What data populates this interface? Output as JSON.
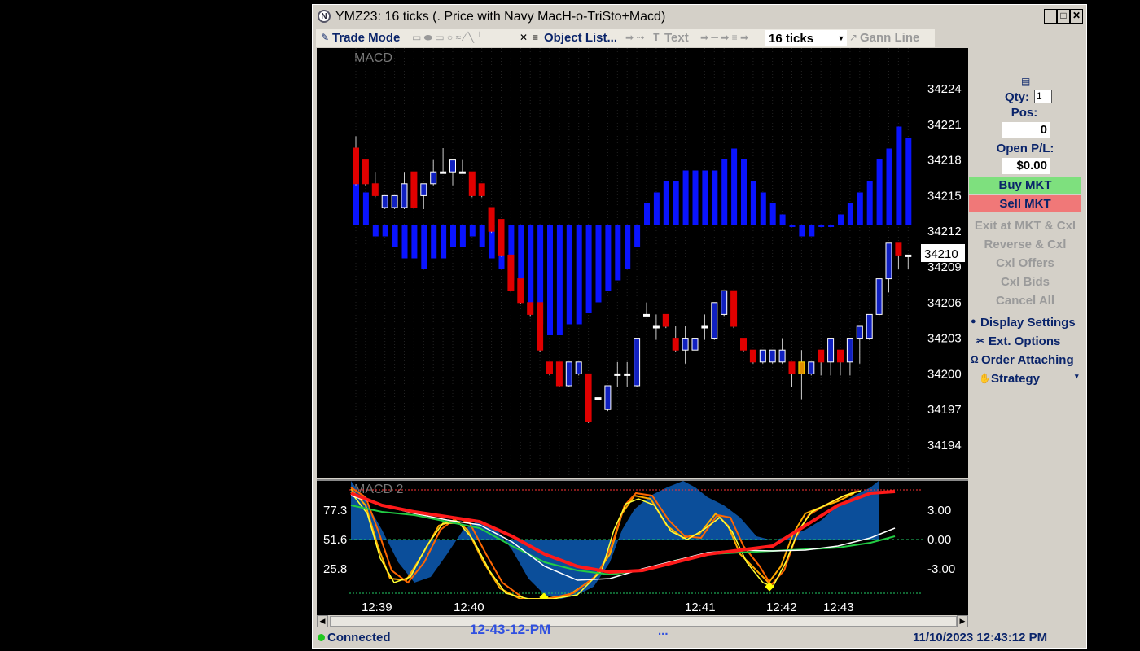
{
  "window": {
    "title": "YMZ23: 16 ticks (. Price with Navy MacH-o-TriSto+Macd)",
    "minimize": "_",
    "maximize": "□",
    "close": "✕"
  },
  "toolbar": {
    "trade_mode": "Trade Mode",
    "object_list": "Object List...",
    "text": "Text",
    "ticks": "16 ticks",
    "gann_line": "Gann Line"
  },
  "main_chart": {
    "label": "MACD",
    "price_axis": [
      "34224",
      "34221",
      "34218",
      "34215",
      "34212",
      "34209",
      "34206",
      "34203",
      "34200",
      "34197",
      "34194"
    ],
    "current_price": "34210"
  },
  "sub_chart": {
    "label": "MACD 2",
    "left_axis": [
      "77.3",
      "51.6",
      "25.8"
    ],
    "right_axis": [
      "3.00",
      "0.00",
      "-3.00"
    ]
  },
  "time_axis": [
    "12:39",
    "12:40",
    "12:41",
    "12:42",
    "12:43"
  ],
  "side_panel": {
    "qty_label": "Qty:",
    "qty_value": "1",
    "pos_label": "Pos:",
    "pos_value": "0",
    "open_pl_label": "Open P/L:",
    "open_pl_value": "$0.00",
    "buy_mkt": "Buy MKT",
    "sell_mkt": "Sell MKT",
    "exit_at_mkt": "Exit at MKT & Cxl",
    "reverse": "Reverse & Cxl",
    "cxl_offers": "Cxl Offers",
    "cxl_bids": "Cxl Bids",
    "cancel_all": "Cancel All",
    "display_settings": "Display Settings",
    "ext_options": "Ext. Options",
    "order_attaching": "Order Attaching",
    "strategy": "Strategy"
  },
  "status": {
    "connection": "Connected",
    "center_time": "12-43-12-PM",
    "ellipsis": "...",
    "datetime": "11/10/2023 12:43:12 PM"
  },
  "colors": {
    "buy": "#7ee07e",
    "sell": "#f07878",
    "histogram": "#0a14ff",
    "connected": "#1ec81e"
  },
  "chart_data": {
    "type": "candlestick",
    "candles": [
      {
        "o": 34216,
        "c": 34219,
        "h": 34220,
        "l": 34216,
        "color": "red"
      },
      {
        "o": 34218,
        "c": 34216,
        "h": 34218,
        "l": 34216,
        "color": "red"
      },
      {
        "o": 34216,
        "c": 34215,
        "h": 34217,
        "l": 34215,
        "color": "red"
      },
      {
        "o": 34215,
        "c": 34214,
        "h": 34215,
        "l": 34214,
        "color": "blue"
      },
      {
        "o": 34215,
        "c": 34214,
        "h": 34215,
        "l": 34214,
        "color": "blue"
      },
      {
        "o": 34214,
        "c": 34216,
        "h": 34217,
        "l": 34214,
        "color": "blue"
      },
      {
        "o": 34217,
        "c": 34214,
        "h": 34217,
        "l": 34214,
        "color": "red"
      },
      {
        "o": 34215,
        "c": 34216,
        "h": 34216,
        "l": 34214,
        "color": "blue"
      },
      {
        "o": 34216,
        "c": 34217,
        "h": 34218,
        "l": 34216,
        "color": "blue"
      },
      {
        "o": 34217,
        "c": 34217,
        "h": 34219,
        "l": 34217,
        "color": "white"
      },
      {
        "o": 34217,
        "c": 34218,
        "h": 34218,
        "l": 34216,
        "color": "blue"
      },
      {
        "o": 34217,
        "c": 34217,
        "h": 34218,
        "l": 34217,
        "color": "white"
      },
      {
        "o": 34217,
        "c": 34215,
        "h": 34217,
        "l": 34215,
        "color": "red"
      },
      {
        "o": 34216,
        "c": 34215,
        "h": 34216,
        "l": 34215,
        "color": "red"
      },
      {
        "o": 34214,
        "c": 34212,
        "h": 34214,
        "l": 34212,
        "color": "red"
      },
      {
        "o": 34213,
        "c": 34210,
        "h": 34213,
        "l": 34210,
        "color": "red"
      },
      {
        "o": 34210,
        "c": 34207,
        "h": 34210,
        "l": 34207,
        "color": "red"
      },
      {
        "o": 34208,
        "c": 34206,
        "h": 34208,
        "l": 34206,
        "color": "red"
      },
      {
        "o": 34206,
        "c": 34205,
        "h": 34206,
        "l": 34205,
        "color": "red"
      },
      {
        "o": 34206,
        "c": 34202,
        "h": 34206,
        "l": 34202,
        "color": "red"
      },
      {
        "o": 34201,
        "c": 34200,
        "h": 34201,
        "l": 34200,
        "color": "red"
      },
      {
        "o": 34201,
        "c": 34199,
        "h": 34201,
        "l": 34199,
        "color": "red"
      },
      {
        "o": 34199,
        "c": 34201,
        "h": 34201,
        "l": 34199,
        "color": "blue"
      },
      {
        "o": 34200,
        "c": 34201,
        "h": 34201,
        "l": 34200,
        "color": "blue"
      },
      {
        "o": 34200,
        "c": 34196,
        "h": 34200,
        "l": 34196,
        "color": "red"
      },
      {
        "o": 34198,
        "c": 34198,
        "h": 34199,
        "l": 34197,
        "color": "white"
      },
      {
        "o": 34197,
        "c": 34199,
        "h": 34199,
        "l": 34197,
        "color": "blue"
      },
      {
        "o": 34200,
        "c": 34200,
        "h": 34201,
        "l": 34199,
        "color": "white"
      },
      {
        "o": 34200,
        "c": 34200,
        "h": 34201,
        "l": 34199,
        "color": "white"
      },
      {
        "o": 34199,
        "c": 34203,
        "h": 34203,
        "l": 34199,
        "color": "blue"
      },
      {
        "o": 34205,
        "c": 34205,
        "h": 34206,
        "l": 34205,
        "color": "white"
      },
      {
        "o": 34204,
        "c": 34204,
        "h": 34205,
        "l": 34203,
        "color": "white"
      },
      {
        "o": 34205,
        "c": 34204,
        "h": 34205,
        "l": 34204,
        "color": "red"
      },
      {
        "o": 34203,
        "c": 34202,
        "h": 34204,
        "l": 34202,
        "color": "red"
      },
      {
        "o": 34202,
        "c": 34203,
        "h": 34204,
        "l": 34201,
        "color": "blue"
      },
      {
        "o": 34202,
        "c": 34203,
        "h": 34203,
        "l": 34201,
        "color": "blue"
      },
      {
        "o": 34204,
        "c": 34204,
        "h": 34205,
        "l": 34203,
        "color": "white"
      },
      {
        "o": 34203,
        "c": 34206,
        "h": 34206,
        "l": 34203,
        "color": "blue"
      },
      {
        "o": 34205,
        "c": 34207,
        "h": 34207,
        "l": 34205,
        "color": "blue"
      },
      {
        "o": 34207,
        "c": 34204,
        "h": 34207,
        "l": 34204,
        "color": "red"
      },
      {
        "o": 34203,
        "c": 34202,
        "h": 34203,
        "l": 34202,
        "color": "red"
      },
      {
        "o": 34202,
        "c": 34201,
        "h": 34202,
        "l": 34201,
        "color": "red"
      },
      {
        "o": 34201,
        "c": 34202,
        "h": 34202,
        "l": 34201,
        "color": "blue"
      },
      {
        "o": 34201,
        "c": 34202,
        "h": 34202,
        "l": 34201,
        "color": "blue"
      },
      {
        "o": 34201,
        "c": 34202,
        "h": 34203,
        "l": 34201,
        "color": "blue"
      },
      {
        "o": 34201,
        "c": 34200,
        "h": 34201,
        "l": 34199,
        "color": "red"
      },
      {
        "o": 34201,
        "c": 34200,
        "h": 34202,
        "l": 34198,
        "color": "orange"
      },
      {
        "o": 34200,
        "c": 34201,
        "h": 34201,
        "l": 34200,
        "color": "blue"
      },
      {
        "o": 34202,
        "c": 34201,
        "h": 34202,
        "l": 34200,
        "color": "red"
      },
      {
        "o": 34201,
        "c": 34203,
        "h": 34203,
        "l": 34200,
        "color": "blue"
      },
      {
        "o": 34202,
        "c": 34201,
        "h": 34202,
        "l": 34200,
        "color": "red"
      },
      {
        "o": 34201,
        "c": 34203,
        "h": 34203,
        "l": 34200,
        "color": "blue"
      },
      {
        "o": 34203,
        "c": 34204,
        "h": 34204,
        "l": 34201,
        "color": "blue"
      },
      {
        "o": 34203,
        "c": 34205,
        "h": 34205,
        "l": 34203,
        "color": "blue"
      },
      {
        "o": 34205,
        "c": 34208,
        "h": 34208,
        "l": 34205,
        "color": "blue"
      },
      {
        "o": 34208,
        "c": 34211,
        "h": 34211,
        "l": 34207,
        "color": "blue"
      },
      {
        "o": 34211,
        "c": 34210,
        "h": 34211,
        "l": 34209,
        "color": "red"
      },
      {
        "o": 34210,
        "c": 34210,
        "h": 34210,
        "l": 34209,
        "color": "white"
      }
    ],
    "histogram": [
      5,
      3,
      -1,
      -1,
      -2,
      -3,
      -3,
      -4,
      -3,
      -3,
      -2,
      -2,
      -1,
      -2,
      -3,
      -4,
      -5,
      -6,
      -7,
      -9,
      -10,
      -10,
      -9,
      -9,
      -8,
      -7,
      -6,
      -5,
      -4,
      -2,
      2,
      3,
      4,
      4,
      5,
      5,
      5,
      5,
      6,
      7,
      6,
      4,
      3,
      2,
      1,
      0,
      -1,
      -1,
      0,
      0,
      1,
      2,
      3,
      4,
      6,
      7,
      9,
      8
    ],
    "sub_levels": {
      "left_axis": [
        77.3,
        51.6,
        25.8
      ],
      "right_axis": [
        3.0,
        0.0,
        -3.0
      ]
    }
  }
}
